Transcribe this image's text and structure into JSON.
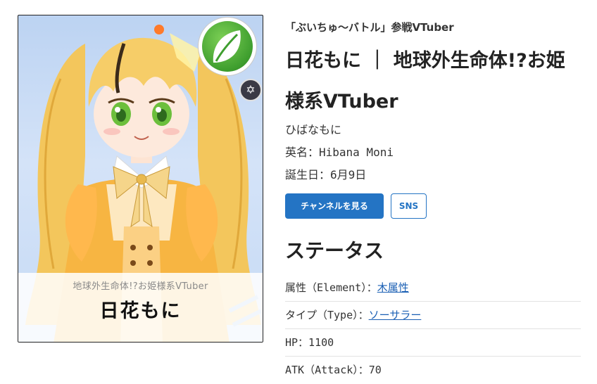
{
  "card": {
    "subtitle": "地球外生命体!?お姫様系VTuber",
    "name": "日花もに",
    "element_icon": "leaf-icon",
    "rank_icon": "hexagram-icon",
    "element_color": "#3e9e2e"
  },
  "profile": {
    "tag": "「ぶいちゅ〜バトル」参戦VTuber",
    "title": "日花もに ｜ 地球外生命体!?お姫様系VTuber",
    "reading": "ひばなもに",
    "english_name": "英名：Hibana Moni",
    "birthday": "誕生日：6月9日"
  },
  "buttons": {
    "channel": "チャンネルを見る",
    "sns": "SNS"
  },
  "status": {
    "heading": "ステータス",
    "element_label": "属性（Element）：",
    "element_value": "木属性",
    "type_label": "タイプ（Type）：",
    "type_value": "ソーサラー",
    "hp": "HP：1100",
    "atk": "ATK（Attack）：70"
  },
  "colors": {
    "accent": "#2474c4",
    "link": "#1a5fb4"
  }
}
